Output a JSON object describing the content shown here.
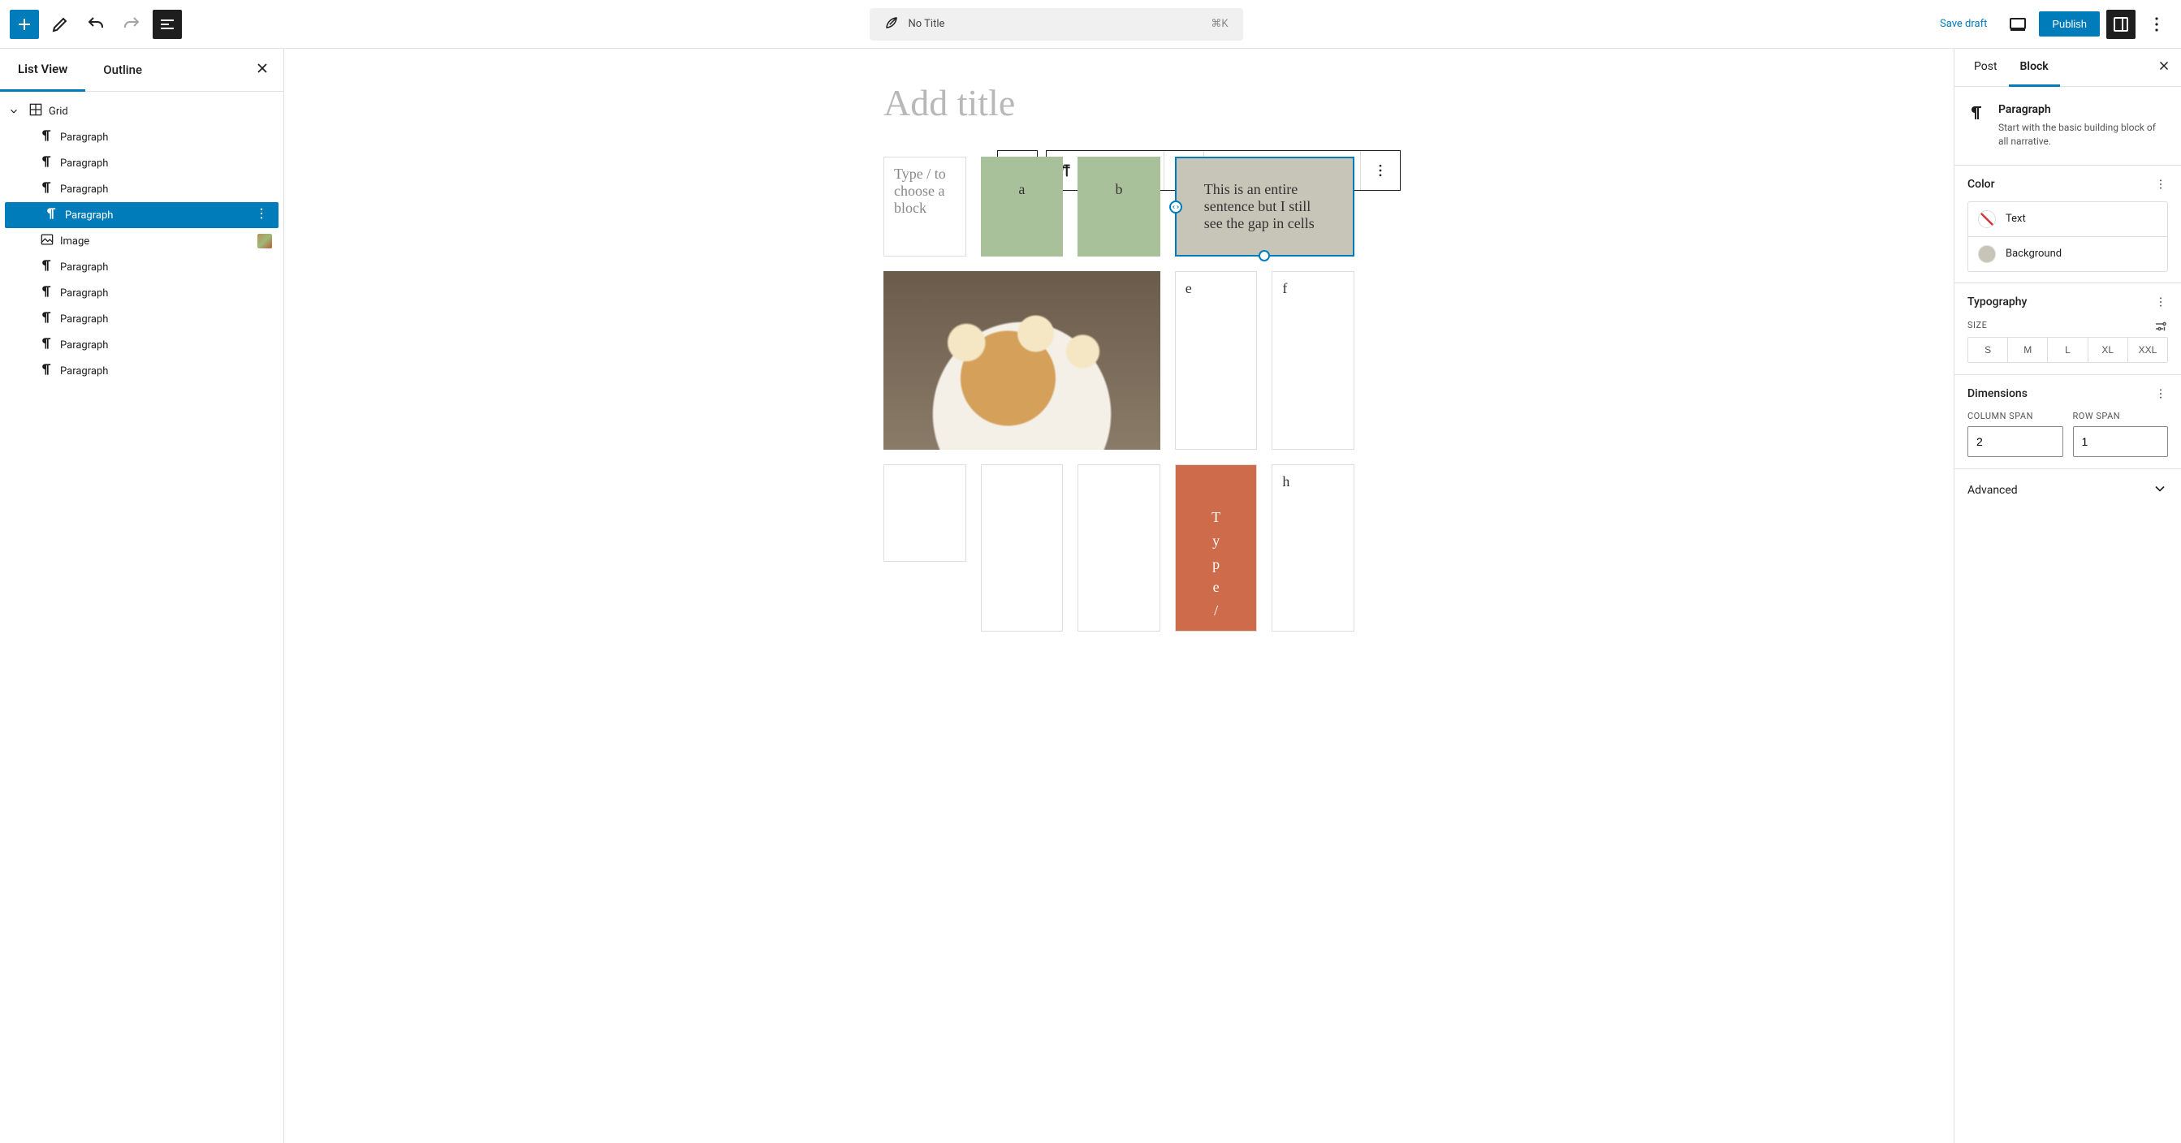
{
  "toolbar": {
    "save_draft": "Save draft",
    "publish": "Publish",
    "shortcut": "⌘K",
    "doc_title": "No Title"
  },
  "left_panel": {
    "tabs": {
      "list_view": "List View",
      "outline": "Outline"
    },
    "tree": {
      "root": "Grid",
      "items": [
        {
          "label": "Paragraph",
          "type": "p"
        },
        {
          "label": "Paragraph",
          "type": "p"
        },
        {
          "label": "Paragraph",
          "type": "p"
        },
        {
          "label": "Paragraph",
          "type": "p",
          "selected": true
        },
        {
          "label": "Image",
          "type": "img"
        },
        {
          "label": "Paragraph",
          "type": "p"
        },
        {
          "label": "Paragraph",
          "type": "p"
        },
        {
          "label": "Paragraph",
          "type": "p"
        },
        {
          "label": "Paragraph",
          "type": "p"
        },
        {
          "label": "Paragraph",
          "type": "p"
        }
      ]
    }
  },
  "editor": {
    "title_placeholder": "Add title",
    "cells": {
      "placeholder": "Type / to choose a block",
      "a": "a",
      "b": "b",
      "sentence": "This is an entire sentence but I still see the gap in cells",
      "e": "e",
      "f": "f",
      "h": "h",
      "tall_text": "T\ny\np\ne\n/"
    }
  },
  "right_panel": {
    "tabs": {
      "post": "Post",
      "block": "Block"
    },
    "header": {
      "name": "Paragraph",
      "desc": "Start with the basic building block of all narrative."
    },
    "color": {
      "title": "Color",
      "text": "Text",
      "background": "Background"
    },
    "typography": {
      "title": "Typography",
      "size_label": "SIZE",
      "sizes": [
        "S",
        "M",
        "L",
        "XL",
        "XXL"
      ]
    },
    "dimensions": {
      "title": "Dimensions",
      "col_span_label": "COLUMN SPAN",
      "row_span_label": "ROW SPAN",
      "col_span": "2",
      "row_span": "1"
    },
    "advanced": "Advanced"
  }
}
